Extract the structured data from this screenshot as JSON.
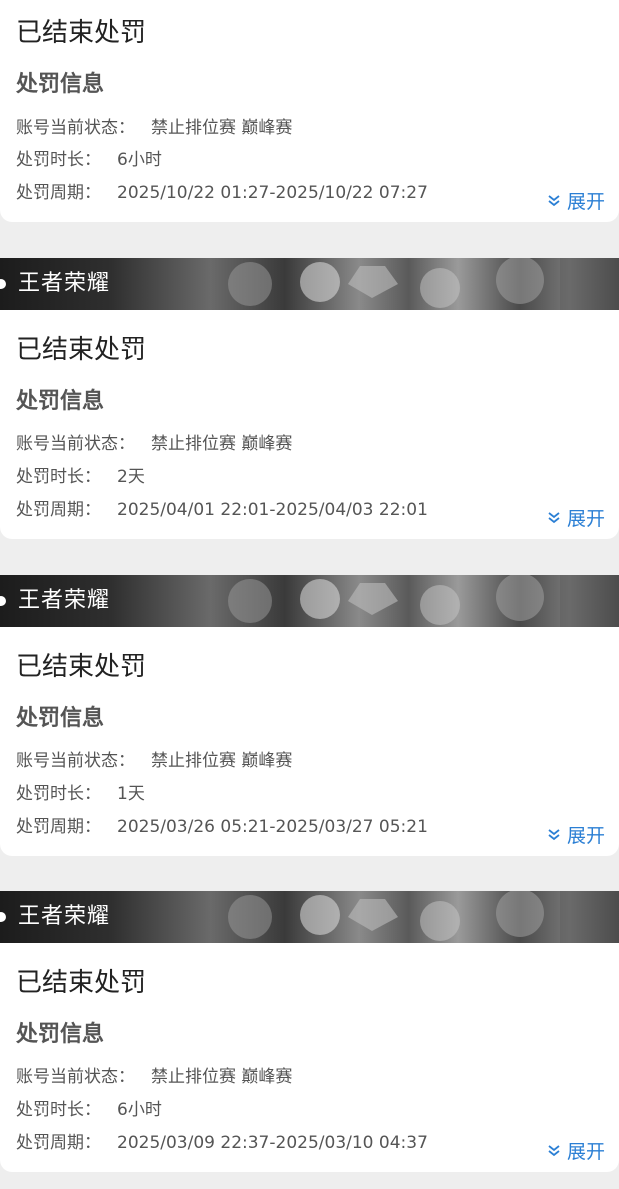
{
  "banner_title": "王者荣耀",
  "labels": {
    "status": "账号当前状态：",
    "duration": "处罚时长：",
    "period": "处罚周期："
  },
  "expand_label": "展开",
  "section_title": "处罚信息",
  "records": [
    {
      "status_title": "已结束处罚",
      "account_status": "禁止排位赛 巅峰赛",
      "duration": "6小时",
      "period": "2025/10/22 01:27-2025/10/22 07:27"
    },
    {
      "status_title": "已结束处罚",
      "account_status": "禁止排位赛 巅峰赛",
      "duration": "2天",
      "period": "2025/04/01 22:01-2025/04/03 22:01"
    },
    {
      "status_title": "已结束处罚",
      "account_status": "禁止排位赛 巅峰赛",
      "duration": "1天",
      "period": "2025/03/26 05:21-2025/03/27 05:21"
    },
    {
      "status_title": "已结束处罚",
      "account_status": "禁止排位赛 巅峰赛",
      "duration": "6小时",
      "period": "2025/03/09 22:37-2025/03/10 04:37"
    }
  ],
  "colors": {
    "accent": "#2b7fd4",
    "card_bg": "#ffffff",
    "page_bg": "#eeeeee"
  },
  "icons": {
    "expand": "double-chevron-down-icon"
  }
}
